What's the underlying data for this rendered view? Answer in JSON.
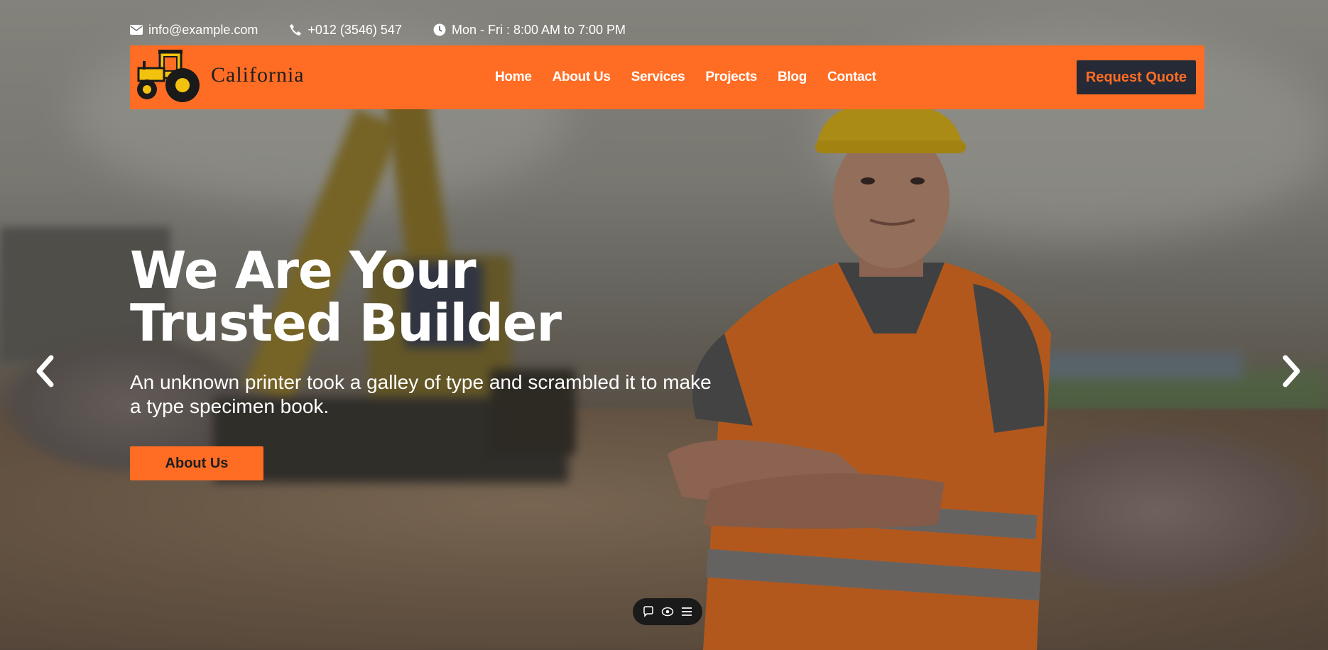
{
  "topbar": {
    "email": "info@example.com",
    "phone": "+012 (3546) 547",
    "hours": "Mon - Fri : 8:00 AM to 7:00 PM"
  },
  "brand": {
    "name": "California"
  },
  "nav": {
    "items": [
      "Home",
      "About Us",
      "Services",
      "Projects",
      "Blog",
      "Contact"
    ],
    "cta": "Request Quote"
  },
  "hero": {
    "title_line1": "We Are Your",
    "title_line2": "Trusted Builder",
    "subtitle": "An unknown printer took a galley of type and scrambled it to make a type specimen book.",
    "button": "About Us"
  },
  "colors": {
    "accent": "#ff6d24",
    "dark": "#262a36",
    "text": "#ffffff"
  },
  "icons": {
    "email": "envelope-icon",
    "phone": "phone-icon",
    "hours": "clock-icon",
    "prev": "chevron-left-icon",
    "next": "chevron-right-icon",
    "chat": "chat-icon",
    "view": "eye-icon",
    "menu": "menu-icon"
  }
}
